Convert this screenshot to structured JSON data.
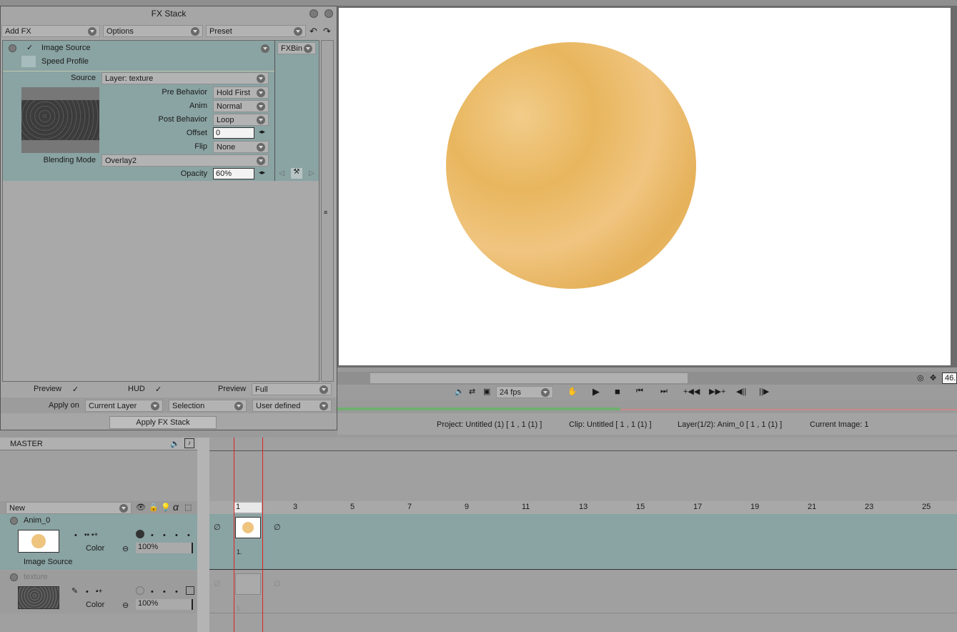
{
  "fx_panel": {
    "title": "FX Stack",
    "toolbar": {
      "add_fx": "Add FX",
      "options": "Options",
      "preset": "Preset"
    },
    "fxbin": "FXBin",
    "effect": {
      "name": "Image Source",
      "speed_profile": "Speed Profile",
      "source_label": "Source",
      "source_value": "Layer: texture",
      "pre_behavior_label": "Pre Behavior",
      "pre_behavior_value": "Hold First",
      "anim_label": "Anim",
      "anim_value": "Normal",
      "post_behavior_label": "Post Behavior",
      "post_behavior_value": "Loop",
      "offset_label": "Offset",
      "offset_value": "0",
      "flip_label": "Flip",
      "flip_value": "None",
      "blending_label": "Blending Mode",
      "blending_value": "Overlay2",
      "opacity_label": "Opacity",
      "opacity_value": "60%"
    },
    "footer": {
      "preview_label": "Preview",
      "hud_label": "HUD",
      "preview2_label": "Preview",
      "preview2_value": "Full",
      "apply_on_label": "Apply on",
      "apply_on_value": "Current Layer",
      "selection_value": "Selection",
      "user_defined_value": "User defined",
      "apply_button": "Apply FX Stack"
    }
  },
  "viewer": {
    "fps": "24 fps",
    "zoom": "46.",
    "status": {
      "project": "Project: Untitled (1) [ 1 , 1  (1) ]",
      "clip": "Clip: Untitled [ 1 , 1  (1) ]",
      "layer": "Layer(1/2): Anim_0 [ 1 , 1  (1) ]",
      "current_image": "Current Image: 1"
    }
  },
  "timeline": {
    "master": "MASTER",
    "new_label": "New",
    "ruler": [
      "1",
      "3",
      "5",
      "7",
      "9",
      "11",
      "13",
      "15",
      "17",
      "19",
      "21",
      "23",
      "25"
    ],
    "layers": [
      {
        "name": "Anim_0",
        "color_label": "Color",
        "opacity": "100%",
        "sub_label": "Image Source",
        "frame_label": "1."
      },
      {
        "name": "texture",
        "color_label": "Color",
        "opacity": "100%",
        "frame_label": "1."
      }
    ]
  }
}
